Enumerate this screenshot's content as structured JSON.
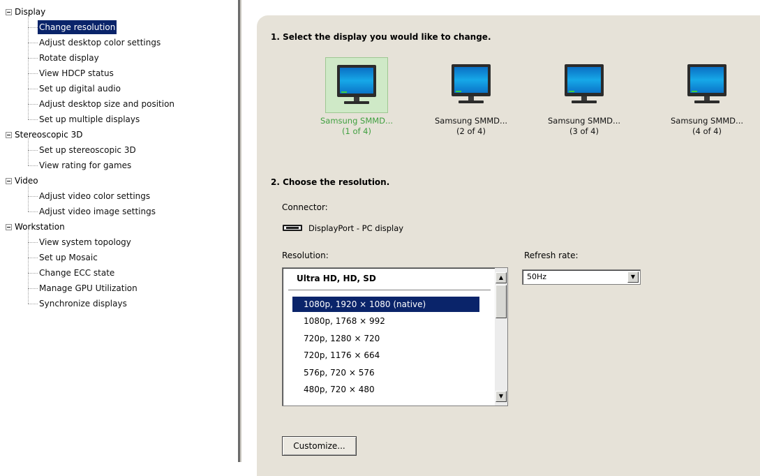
{
  "nav": {
    "groups": [
      {
        "label": "Display",
        "items": [
          "Change resolution",
          "Adjust desktop color settings",
          "Rotate display",
          "View HDCP status",
          "Set up digital audio",
          "Adjust desktop size and position",
          "Set up multiple displays"
        ]
      },
      {
        "label": "Stereoscopic 3D",
        "items": [
          "Set up stereoscopic 3D",
          "View rating for games"
        ]
      },
      {
        "label": "Video",
        "items": [
          "Adjust video color settings",
          "Adjust video image settings"
        ]
      },
      {
        "label": "Workstation",
        "items": [
          "View system topology",
          "Set up Mosaic",
          "Change ECC state",
          "Manage GPU Utilization",
          "Synchronize displays"
        ]
      }
    ],
    "selected": "Change resolution"
  },
  "step1": {
    "title": "1. Select the display you would like to change.",
    "displays": [
      {
        "name": "Samsung SMMD...",
        "index": "(1 of 4)",
        "selected": true
      },
      {
        "name": "Samsung SMMD...",
        "index": "(2 of 4)",
        "selected": false
      },
      {
        "name": "Samsung SMMD...",
        "index": "(3 of 4)",
        "selected": false
      },
      {
        "name": "Samsung SMMD...",
        "index": "(4 of 4)",
        "selected": false
      }
    ]
  },
  "step2": {
    "title": "2. Choose the resolution.",
    "connector_label": "Connector:",
    "connector_value": "DisplayPort - PC display",
    "resolution_label": "Resolution:",
    "refresh_label": "Refresh rate:",
    "resolution_group": "Ultra HD, HD, SD",
    "resolutions": [
      "1080p, 1920 × 1080 (native)",
      "1080p, 1768 × 992",
      "720p, 1280 × 720",
      "720p, 1176 × 664",
      "576p, 720 × 576",
      "480p, 720 × 480"
    ],
    "selected_resolution": "1080p, 1920 × 1080 (native)",
    "refresh_value": "50Hz",
    "customize_label": "Customize..."
  },
  "colors": {
    "selection": "#0a246a",
    "panel_bg": "#e6e2d8",
    "selected_display_text": "#40a040",
    "selected_tile_bg": "#cfe9c7"
  }
}
